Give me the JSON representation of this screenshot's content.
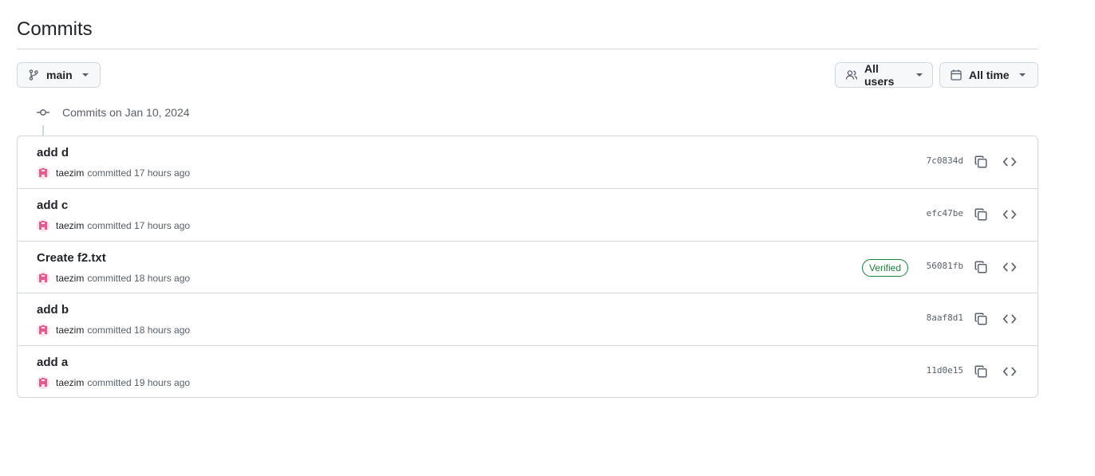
{
  "header": {
    "title": "Commits"
  },
  "filters": {
    "branch_label": "main",
    "users_label": "All users",
    "time_label": "All time"
  },
  "timeline": {
    "date_label": "Commits on Jan 10, 2024"
  },
  "commits": [
    {
      "message": "add d",
      "author": "taezim",
      "time": "committed 17 hours ago",
      "sha": "7c0834d",
      "verified": ""
    },
    {
      "message": "add c",
      "author": "taezim",
      "time": "committed 17 hours ago",
      "sha": "efc47be",
      "verified": ""
    },
    {
      "message": "Create f2.txt",
      "author": "taezim",
      "time": "committed 18 hours ago",
      "sha": "56081fb",
      "verified": "Verified"
    },
    {
      "message": "add b",
      "author": "taezim",
      "time": "committed 18 hours ago",
      "sha": "8aaf8d1",
      "verified": ""
    },
    {
      "message": "add a",
      "author": "taezim",
      "time": "committed 19 hours ago",
      "sha": "11d0e15",
      "verified": ""
    }
  ],
  "colors": {
    "border": "#d0d7de",
    "muted_text": "#57606a",
    "verified_green": "#1a7f37",
    "avatar_pink": "#e05d8f"
  },
  "icons": {
    "branch": "git-branch-icon",
    "users": "people-icon",
    "time": "calendar-icon",
    "timeline": "git-commit-icon",
    "copy": "copy-icon",
    "browse": "code-icon"
  }
}
